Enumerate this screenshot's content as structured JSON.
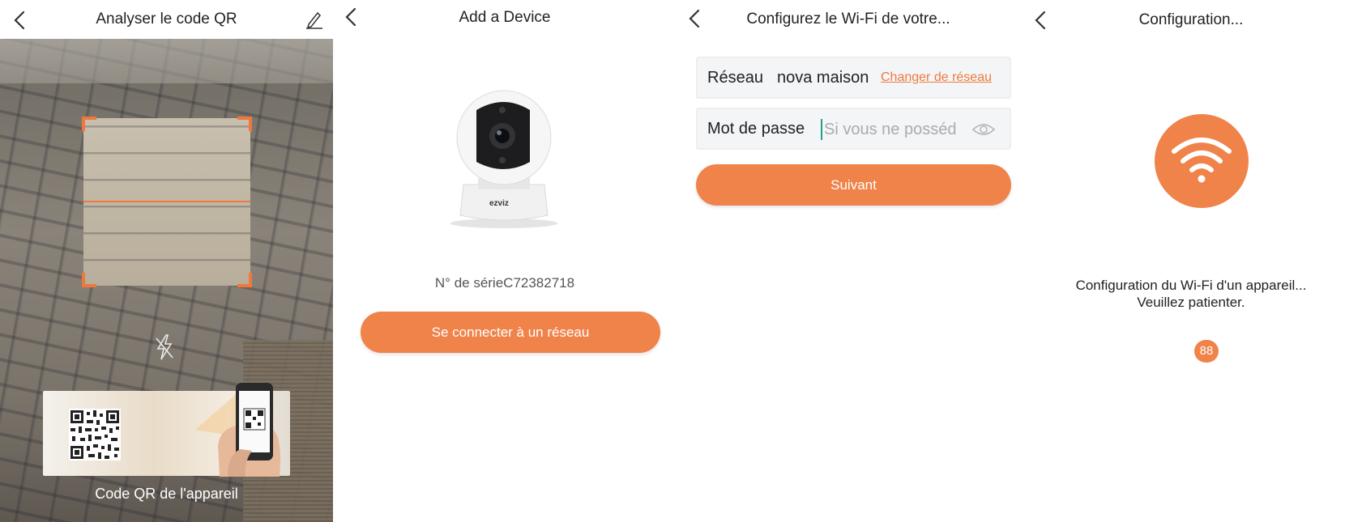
{
  "screen1": {
    "title": "Analyser le code QR",
    "back_icon": "chevron-left-icon",
    "edit_icon": "pencil-icon",
    "flash_icon": "flash-off-icon",
    "qr_caption": "Code QR de l'appareil"
  },
  "screen2": {
    "title": "Add a Device",
    "device_brand": "ezviz",
    "serial_text": "N° de sérieC72382718",
    "connect_button": "Se connecter à un réseau"
  },
  "screen3": {
    "title": "Configurez le Wi-Fi de votre...",
    "network_label": "Réseau",
    "network_value": "nova maison",
    "change_network": "Changer de réseau",
    "password_label": "Mot de passe",
    "password_placeholder": "Si vous ne possédez",
    "eye_icon": "eye-icon",
    "next_button": "Suivant"
  },
  "screen4": {
    "title": "Configuration...",
    "wifi_icon": "wifi-icon",
    "status_line1": "Configuration du Wi-Fi d'un appareil...",
    "status_line2": "Veuillez patienter.",
    "countdown": "88"
  },
  "colors": {
    "accent": "#f0834a",
    "link": "#f07a3e",
    "field_bg": "#f3f5f7"
  }
}
